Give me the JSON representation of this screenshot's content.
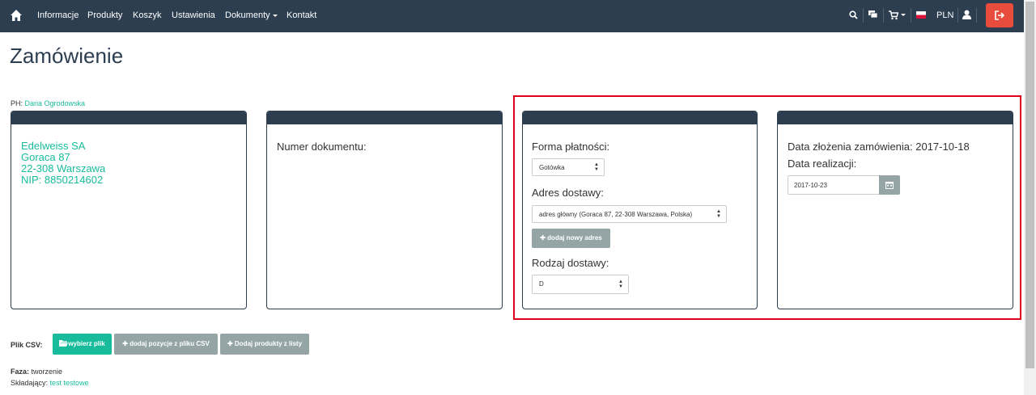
{
  "navbar": {
    "items": [
      "Informacje",
      "Produkty",
      "Koszyk",
      "Ustawienia",
      "Dokumenty",
      "Kontakt"
    ],
    "currency": "PLN",
    "colors": {
      "bg": "#2c3e50",
      "logout": "#e74c3c"
    }
  },
  "page": {
    "title": "Zamówienie",
    "ph_label": "PH:",
    "ph_name": "Daria Ogrodowska"
  },
  "client": {
    "lines": [
      "Edelweiss SA",
      "Goraca 87",
      "22-308 Warszawa",
      "NIP: 8850214602"
    ]
  },
  "document": {
    "number_label": "Numer dokumentu:"
  },
  "payment": {
    "label": "Forma płatności:",
    "value": "Gotówka"
  },
  "delivery": {
    "address_label": "Adres dostawy:",
    "address_value": "adres główny (Goraca 87, 22-308 Warszawa, Polska)",
    "add_address_label": "dodaj nowy adres",
    "type_label": "Rodzaj dostawy:",
    "type_value": "D"
  },
  "dates": {
    "order_date_label": "Data złożenia zamówienia: 2017-10-18",
    "realization_label": "Data realizacji:",
    "realization_value": "2017-10-23"
  },
  "csv": {
    "label": "Plik CSV:",
    "choose_file": "wybierz plik",
    "add_from_csv": "dodaj pozycje z pliku CSV",
    "add_from_list": "Dodaj produkty z listy"
  },
  "status": {
    "phase_label": "Faza:",
    "phase_value": "tworzenie",
    "author_label": "Składający:",
    "author_value": "test testowe"
  },
  "accent": "#18bc9c",
  "highlight_color": "#e0001b"
}
